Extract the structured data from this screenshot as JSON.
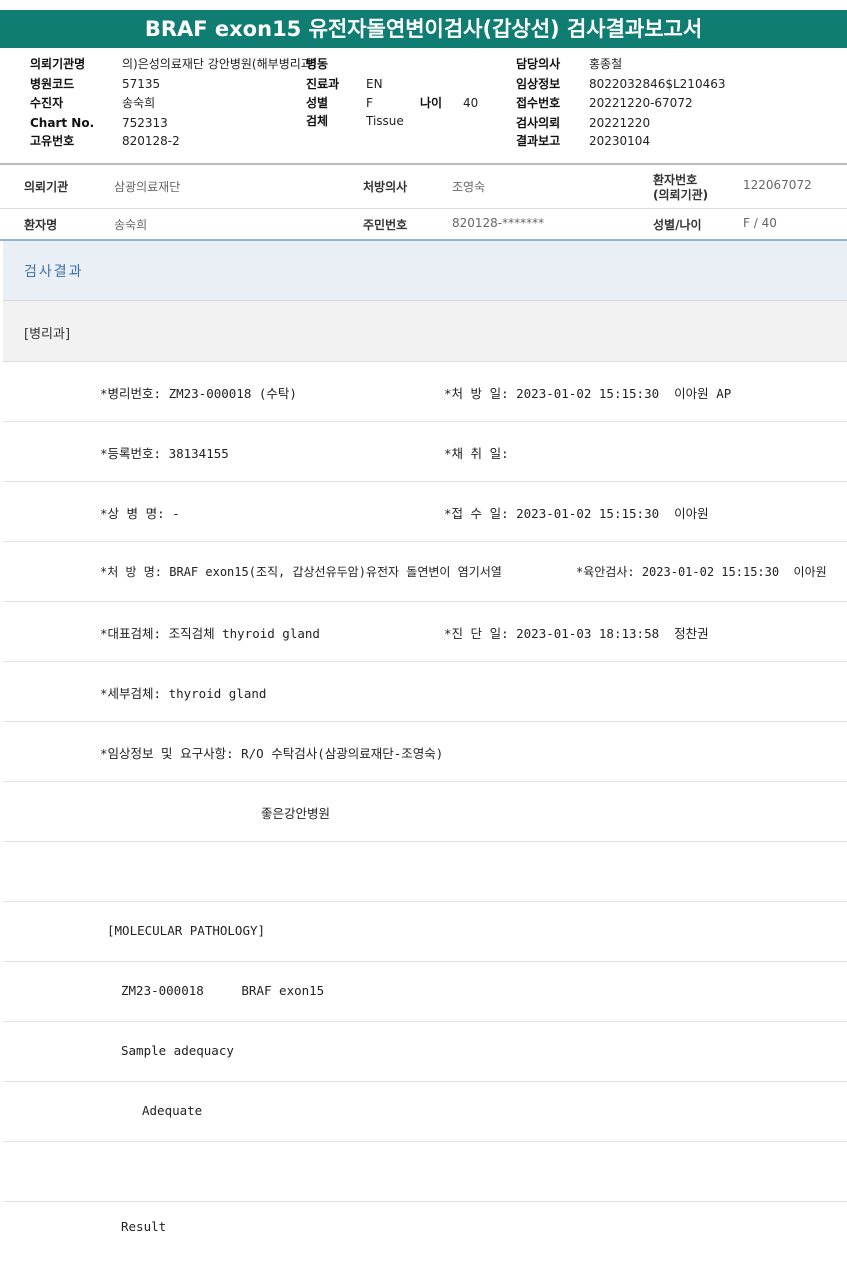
{
  "title": "BRAF exon15 유전자돌연변이검사(갑상선) 검사결과보고서",
  "header": {
    "col1": [
      {
        "label": "의뢰기관명",
        "value": "의)은성의료재단 강안병원(해부병리과)"
      },
      {
        "label": "병원코드",
        "value": "57135"
      },
      {
        "label": "수진자",
        "value": "송숙희"
      },
      {
        "label": "Chart No.",
        "value": "752313"
      },
      {
        "label": "고유번호",
        "value": "820128-2"
      }
    ],
    "col2": [
      {
        "label": "병동",
        "value": ""
      },
      {
        "label": "진료과",
        "value": "EN"
      },
      {
        "label": "성별",
        "value": "F"
      },
      {
        "label": "검체",
        "value": "Tissue"
      }
    ],
    "age": {
      "label": "나이",
      "value": "40"
    },
    "col3": [
      {
        "label": "담당의사",
        "value": "홍종철"
      },
      {
        "label": "임상정보",
        "value": "8022032846$L210463"
      },
      {
        "label": "접수번호",
        "value": "20221220-67072"
      },
      {
        "label": "검사의뢰",
        "value": "20221220"
      },
      {
        "label": "결과보고",
        "value": "20230104"
      }
    ]
  },
  "patient": {
    "row1": {
      "inst_label": "의뢰기관",
      "inst_value": "삼광의료재단",
      "doctor_label": "처방의사",
      "doctor_value": "조영숙",
      "pid_label_1": "환자번호",
      "pid_label_2": "(의뢰기관)",
      "pid_value": "122067072"
    },
    "row2": {
      "name_label": "환자명",
      "name_value": "송숙희",
      "rrn_label": "주민번호",
      "rrn_value": "820128-*******",
      "sexage_label": "성별/나이",
      "sexage_value": "F / 40"
    }
  },
  "result_section": "검사결과",
  "department": "[병리과]",
  "rows": [
    {
      "a": "*병리번호: ZM23-000018 (수탁)",
      "b": "*처 방 일: 2023-01-02 15:15:30  이아원 AP"
    },
    {
      "a": "*등록번호: 38134155",
      "b": "*채 취 일:"
    },
    {
      "a": "*상 병 명: -",
      "b": "*접 수 일: 2023-01-02 15:15:30  이아원"
    },
    {
      "a": "*처 방 명: BRAF exon15(조직, 갑상선유두암)유전자 돌연변이 염기서열",
      "b": "*육안검사: 2023-01-02 15:15:30  이아원"
    },
    {
      "a": "*대표검체: 조직검체 thyroid gland",
      "b": "*진 단 일: 2023-01-03 18:13:58  정찬권"
    },
    {
      "a": "*세부검체: thyroid gland",
      "b": ""
    },
    {
      "a": "*임상정보 및 요구사항: R/O 수탁검사(삼광의료재단-조영숙)",
      "b": ""
    },
    {
      "a": "좋은강안병원",
      "b": ""
    },
    {
      "a": "",
      "b": ""
    },
    {
      "a": "[MOLECULAR PATHOLOGY]",
      "b": ""
    },
    {
      "a": "ZM23-000018     BRAF exon15",
      "b": ""
    },
    {
      "a": "Sample adequacy",
      "b": ""
    },
    {
      "a": "Adequate",
      "b": ""
    },
    {
      "a": "",
      "b": ""
    },
    {
      "a": "Result",
      "b": ""
    }
  ]
}
